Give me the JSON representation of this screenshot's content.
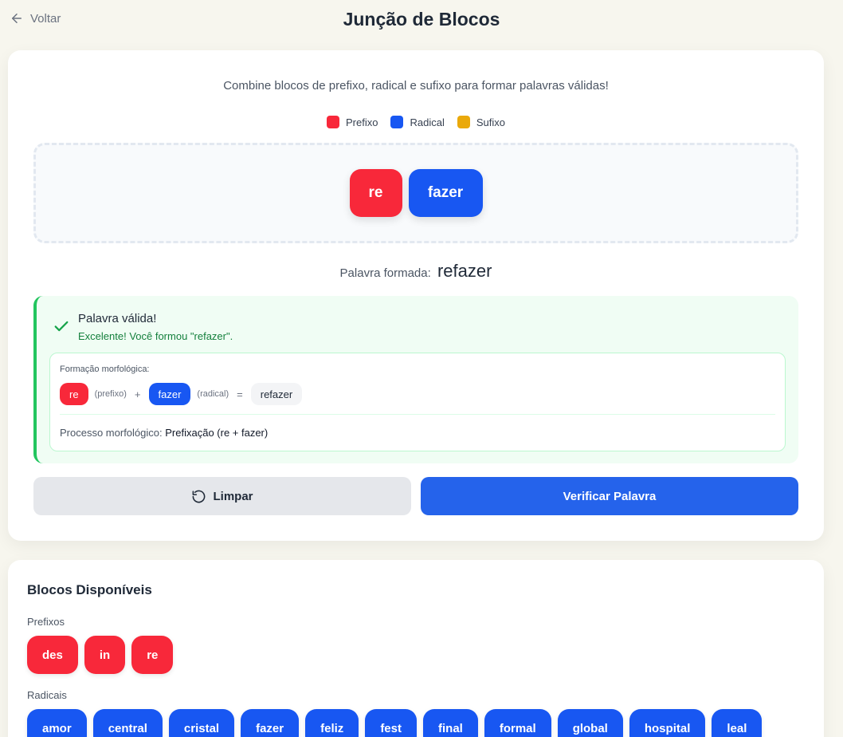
{
  "colors": {
    "prefix": "#f8283a",
    "radical": "#1857f2",
    "suffix": "#eaa90b"
  },
  "header": {
    "back_label": "Voltar",
    "title": "Junção de Blocos"
  },
  "game": {
    "instruction": "Combine blocos de prefixo, radical e sufixo para formar palavras válidas!",
    "legend": {
      "prefix": "Prefixo",
      "radical": "Radical",
      "suffix": "Sufixo"
    },
    "dropzone": {
      "blocks": [
        "re",
        "fazer"
      ]
    },
    "formed_label": "Palavra formada:",
    "formed_word": "refazer",
    "result": {
      "title": "Palavra válida!",
      "message": "Excelente! Você formou \"refazer\".",
      "morph_label": "Formação morfológica:",
      "part1": "re",
      "part1_type": "(prefixo)",
      "plus": "+",
      "part2": "fazer",
      "part2_type": "(radical)",
      "equals": "=",
      "result_word": "refazer",
      "process_label": "Processo morfológico:",
      "process_value": "Prefixação (re + fazer)"
    },
    "buttons": {
      "clear": "Limpar",
      "verify": "Verificar Palavra"
    }
  },
  "available": {
    "title": "Blocos Disponíveis",
    "prefixes_label": "Prefixos",
    "prefixes": [
      "des",
      "in",
      "re"
    ],
    "radicals_label": "Radicais",
    "radicals": [
      "amor",
      "central",
      "cristal",
      "fazer",
      "feliz",
      "fest",
      "final",
      "formal",
      "global",
      "hospital",
      "leal"
    ]
  }
}
